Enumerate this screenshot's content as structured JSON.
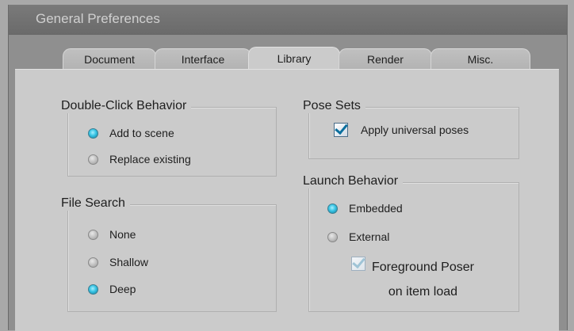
{
  "window": {
    "title": "General Preferences"
  },
  "tabs": [
    {
      "label": "Document",
      "active": false
    },
    {
      "label": "Interface",
      "active": false
    },
    {
      "label": "Library",
      "active": true
    },
    {
      "label": "Render",
      "active": false
    },
    {
      "label": "Misc.",
      "active": false
    }
  ],
  "double_click": {
    "title": "Double-Click Behavior",
    "options": [
      {
        "label": "Add to scene",
        "selected": true
      },
      {
        "label": "Replace existing",
        "selected": false
      }
    ]
  },
  "file_search": {
    "title": "File Search",
    "options": [
      {
        "label": "None",
        "selected": false
      },
      {
        "label": "Shallow",
        "selected": false
      },
      {
        "label": "Deep",
        "selected": true
      }
    ]
  },
  "pose_sets": {
    "title": "Pose Sets",
    "apply_universal_label": "Apply universal poses",
    "apply_universal_checked": true
  },
  "launch_behavior": {
    "title": "Launch Behavior",
    "options": [
      {
        "label": "Embedded",
        "selected": true
      },
      {
        "label": "External",
        "selected": false
      }
    ],
    "foreground_line1": "Foreground Poser",
    "foreground_line2": "on item load",
    "foreground_checked": true
  },
  "colors": {
    "radio_selected": "#38c4e4",
    "panel_bg": "#cbcbcb",
    "title_bar": "#6a6a6a"
  }
}
